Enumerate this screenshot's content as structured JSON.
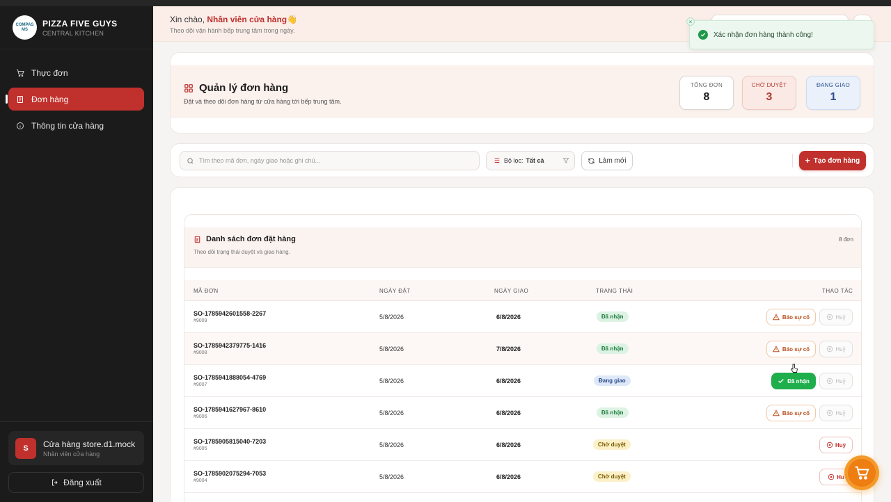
{
  "brand": {
    "title": "PIZZA FIVE GUYS",
    "subtitle": "CENTRAL KITCHEN",
    "logo_text": "COMPAS MS"
  },
  "sidebar": {
    "items": [
      {
        "label": "Thực đơn",
        "icon": "cart-icon",
        "active": false
      },
      {
        "label": "Đơn hàng",
        "icon": "receipt-icon",
        "active": true
      },
      {
        "label": "Thông tin cửa hàng",
        "icon": "info-icon",
        "active": false
      }
    ],
    "user": {
      "initial": "S",
      "name": "Cửa hàng store.d1.mock",
      "role": "Nhân viên cửa hàng"
    },
    "logout_label": "Đăng xuất"
  },
  "header": {
    "greeting_prefix": "Xin chào,",
    "greeting_name": "Nhân viên cửa hàng",
    "greeting_emoji": "👋",
    "subtitle": "Theo dõi vận hành bếp trung tâm trong ngày."
  },
  "toast": {
    "message": "Xác nhận đơn hàng thành công!",
    "close": "×",
    "color": "#1f9a4b"
  },
  "summary": {
    "title": "Quản lý đơn hàng",
    "subtitle": "Đặt và theo dõi đơn hàng từ cửa hàng tới bếp trung tâm.",
    "stats": [
      {
        "label": "TỔNG ĐƠN",
        "value": "8"
      },
      {
        "label": "CHỜ DUYỆT",
        "value": "3"
      },
      {
        "label": "ĐANG GIAO",
        "value": "1"
      }
    ]
  },
  "toolbar": {
    "search_placeholder": "Tìm theo mã đơn, ngày giao hoặc ghi chú...",
    "filter_label": "Bộ lọc:",
    "filter_value": "Tất cả",
    "refresh_label": "Làm mới",
    "create_label": "Tạo đơn hàng"
  },
  "list": {
    "title": "Danh sách đơn đặt hàng",
    "subtitle": "Theo dõi trạng thái duyệt và giao hàng.",
    "count": "8 đơn",
    "columns": [
      "MÃ ĐƠN",
      "NGÀY ĐẶT",
      "NGÀY GIAO",
      "TRẠNG THÁI",
      "THAO TÁC"
    ],
    "rows": [
      {
        "code": "SO-1785942601558-2267",
        "sub": "#9009",
        "order_date": "5/8/2026",
        "delivery_date": "6/8/2026",
        "status": "Đã nhận",
        "status_type": "recv",
        "action_primary": "Báo sự cố",
        "action_cancel": "Huỷ"
      },
      {
        "code": "SO-1785942379775-1416",
        "sub": "#9008",
        "order_date": "5/8/2026",
        "delivery_date": "7/8/2026",
        "status": "Đã nhận",
        "status_type": "recv",
        "action_primary": "Báo sự cố",
        "action_cancel": "Huỷ"
      },
      {
        "code": "SO-1785941888054-4769",
        "sub": "#9007",
        "order_date": "5/8/2026",
        "delivery_date": "6/8/2026",
        "status": "Đang giao",
        "status_type": "ship",
        "action_primary": "Đã nhận",
        "action_cancel": "Huỷ"
      },
      {
        "code": "SO-1785941627967-8610",
        "sub": "#9006",
        "order_date": "5/8/2026",
        "delivery_date": "6/8/2026",
        "status": "Đã nhận",
        "status_type": "recv",
        "action_primary": "Báo sự cố",
        "action_cancel": "Huỷ"
      },
      {
        "code": "SO-1785905815040-7203",
        "sub": "#9005",
        "order_date": "5/8/2026",
        "delivery_date": "6/8/2026",
        "status": "Chờ duyệt",
        "status_type": "pend",
        "action_primary": "",
        "action_cancel": "Huỷ"
      },
      {
        "code": "SO-1785902075294-7053",
        "sub": "#9004",
        "order_date": "5/8/2026",
        "delivery_date": "6/8/2026",
        "status": "Chờ duyệt",
        "status_type": "pend",
        "action_primary": "",
        "action_cancel": "Hu"
      }
    ]
  },
  "colors": {
    "accent": "#c0302c",
    "sidebar_bg": "#1b1b1b",
    "success": "#1fae4c",
    "cart": "#f39a2a"
  }
}
